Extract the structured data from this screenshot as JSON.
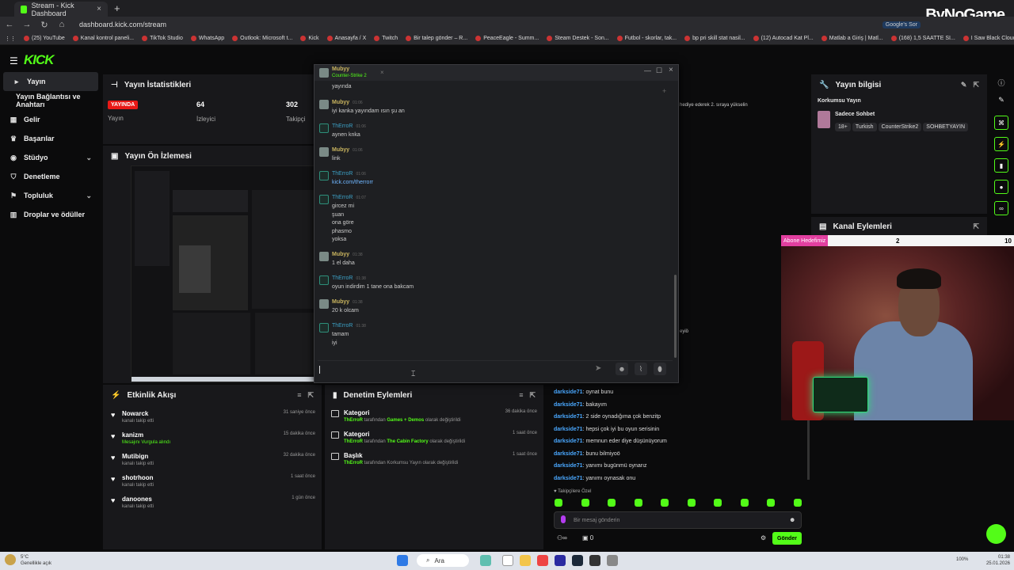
{
  "browser": {
    "tab_title": "Stream - Kick Dashboard",
    "url": "dashboard.kick.com/stream",
    "bookmarks": [
      "(25) YouTube",
      "Kanal kontrol paneli...",
      "TikTok Studio",
      "WhatsApp",
      "Outlook: Microsoft t...",
      "Kick",
      "Anasayfa / X",
      "Twitch",
      "Bir talep gönder – R...",
      "PeaceEagle - Summ...",
      "Steam Destek - Son...",
      "Futbol - skorlar, tak...",
      "bp pri skill stat nasil...",
      "(12) Autocad Kat Pl...",
      "Matlab a Giriş | Matl...",
      "(168) 1,5 SAATTE SI...",
      "I Saw Black Clouds -..."
    ],
    "all_bookmarks": "Tüm Yer İşaretleri",
    "google_label": "Google's Sor",
    "watermark": "ByNoGame"
  },
  "kick": {
    "logo": "KICK"
  },
  "sidebar": {
    "items": [
      {
        "label": "Yayın"
      },
      {
        "label": "Yayın Bağlantısı ve Anahtarı"
      },
      {
        "label": "Gelir"
      },
      {
        "label": "Başarılar"
      },
      {
        "label": "Stüdyo"
      },
      {
        "label": "Denetleme"
      },
      {
        "label": "Topluluk"
      },
      {
        "label": "Droplar ve ödüller"
      }
    ]
  },
  "stats": {
    "title": "Yayın İstatistikleri",
    "live_badge": "YAYINDA",
    "live_label": "Yayın",
    "viewers_value": "64",
    "viewers_label": "İzleyici",
    "followers_value": "302",
    "followers_label": "Takipçi"
  },
  "preview": {
    "title": "Yayın Ön İzlemesi"
  },
  "events": {
    "title": "Etkinlik Akışı",
    "items": [
      {
        "name": "Nowarck",
        "sub": "kanalı takip etti",
        "time": "31 saniye önce",
        "green": false
      },
      {
        "name": "kanizm",
        "sub": "Mesajını Vurgula alındı",
        "time": "15 dakika önce",
        "green": true
      },
      {
        "name": "Mutibign",
        "sub": "kanalı takip etti",
        "time": "32 dakika önce",
        "green": false
      },
      {
        "name": "shotrhoon",
        "sub": "kanalı takip etti",
        "time": "1 saat önce",
        "green": false
      },
      {
        "name": "danoones",
        "sub": "kanalı takip etti",
        "time": "1 gün önce",
        "green": false
      }
    ]
  },
  "moderation": {
    "title": "Denetim Eylemleri",
    "items": [
      {
        "name": "Kategori",
        "actor": "ThErroR",
        "mid": " tarafından ",
        "target": "Games + Demos",
        "end": " olarak değiştirildi",
        "time": "36 dakika önce"
      },
      {
        "name": "Kategori",
        "actor": "ThErroR",
        "mid": " tarafından ",
        "target": "The Cabin Factory",
        "end": " olarak değiştirildi",
        "time": "1 saat önce"
      },
      {
        "name": "Başlık",
        "actor": "ThErroR",
        "mid": " tarafından ",
        "target": "Korkumsu Yayın",
        "end": " olarak değiştirildi",
        "time": "1 saat önce"
      }
    ]
  },
  "chat": {
    "lines": [
      {
        "user": "darkside71",
        "text": ": oynat bunu"
      },
      {
        "user": "darkside71",
        "text": ": bakayım"
      },
      {
        "user": "darkside71",
        "text": ": 2 side oynadığıma çok benzitp"
      },
      {
        "user": "darkside71",
        "text": ": hepsi çok iyi bu oyun serisinin"
      },
      {
        "user": "darkside71",
        "text": ": memnun eder diye düşünüyorum"
      },
      {
        "user": "darkside71",
        "text": ": bunu bilmiyoö"
      },
      {
        "user": "darkside71",
        "text": ": yanımı bugünmü oynarız"
      },
      {
        "user": "darkside71",
        "text": ": yanımı oynasak onu"
      }
    ],
    "followers_only": "Takipçilere Özel",
    "placeholder": "Bir mesaj gönderin",
    "send": "Gönder",
    "viewer_count": "0",
    "partial_text_1": "hediye ederek 2. sıraya yükselin",
    "partial_text_2": "eyiö"
  },
  "info": {
    "title": "Yayın bilgisi",
    "stream_title": "Korkumsu Yayın",
    "category": "Sadece Sohbet",
    "tags": [
      "18+",
      "Turkish",
      "CounterStrike2",
      "SOHBETYAYIN"
    ]
  },
  "actions": {
    "title": "Kanal Eylemleri"
  },
  "subgoal": {
    "label": "Abone Hedefimiz",
    "current": "2",
    "target": "10",
    "progress": 0.2
  },
  "popup": {
    "user": "Mubyy",
    "game": "Counter-Strike 2",
    "messages": [
      {
        "user": "",
        "time": "",
        "lines": [
          "yayında"
        ],
        "er": false,
        "partial": true
      },
      {
        "user": "Mubyy",
        "time": "01:06",
        "lines": [
          "iyi kanka yayındam ısın şu an"
        ],
        "er": false
      },
      {
        "user": "ThErroR",
        "time": "01:06",
        "lines": [
          "aynen knka"
        ],
        "er": true
      },
      {
        "user": "Mubyy",
        "time": "01:06",
        "lines": [
          "link"
        ],
        "er": false
      },
      {
        "user": "ThErroR",
        "time": "01:06",
        "lines": [
          "kick.com/therrorr"
        ],
        "er": true,
        "link": true
      },
      {
        "user": "ThErroR",
        "time": "01:07",
        "lines": [
          "gircez mi",
          "şuan",
          "ona göre",
          "phasmo",
          "yoksa"
        ],
        "er": true
      },
      {
        "user": "Mubyy",
        "time": "01:38",
        "lines": [
          "1 el daha"
        ],
        "er": false
      },
      {
        "user": "ThErroR",
        "time": "01:38",
        "lines": [
          "oyun indirdim 1 tane ona bakcam"
        ],
        "er": true
      },
      {
        "user": "Mubyy",
        "time": "01:38",
        "lines": [
          "20 k olcam"
        ],
        "er": false
      },
      {
        "user": "ThErroR",
        "time": "01:38",
        "lines": [
          "tamam",
          "iyi"
        ],
        "er": true
      }
    ]
  },
  "taskbar": {
    "weather_temp": "5°C",
    "weather_desc": "Genellikle açık",
    "search": "Ara",
    "time": "01:38",
    "date": "25.01.2026",
    "battery": "100%"
  },
  "colors": {
    "kick_green": "#53fc18",
    "live_red": "#e91916",
    "panel": "#18181b",
    "sub_pink": "#e23fa0"
  }
}
